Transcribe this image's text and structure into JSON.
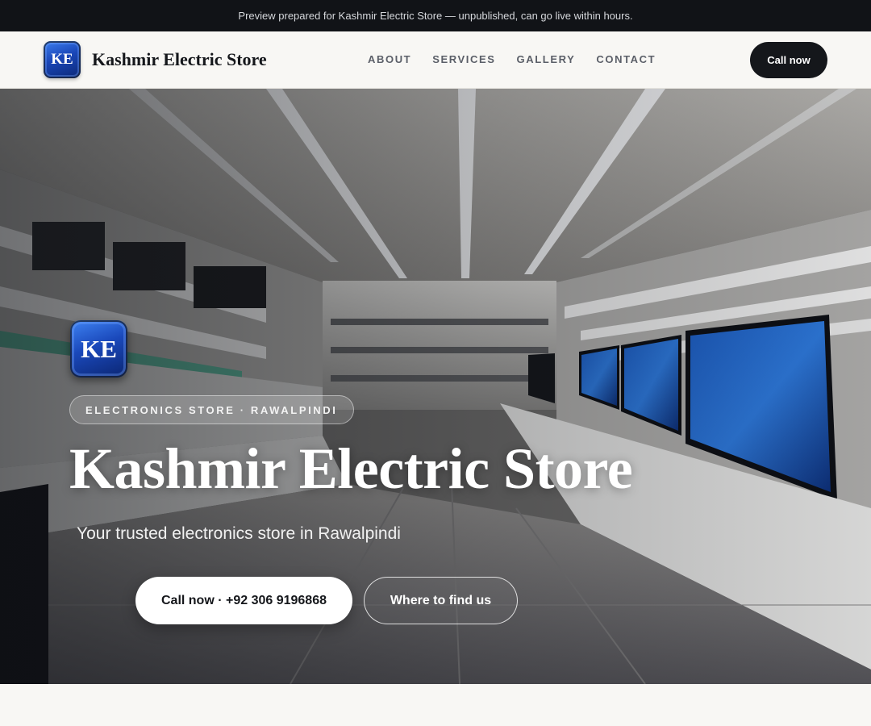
{
  "preview_bar": {
    "text": "Preview prepared for Kashmir Electric Store — unpublished, can go live within hours."
  },
  "header": {
    "logo_text": "KE",
    "brand_name": "Kashmir Electric Store",
    "nav": [
      {
        "label": "ABOUT"
      },
      {
        "label": "SERVICES"
      },
      {
        "label": "GALLERY"
      },
      {
        "label": "CONTACT"
      }
    ],
    "cta_label": "Call now"
  },
  "hero": {
    "logo_text": "KE",
    "badge": "ELECTRONICS STORE · RAWALPINDI",
    "title": "Kashmir Electric Store",
    "subtitle": "Your trusted electronics store in Rawalpindi",
    "primary_button": "Call now · +92 306 9196868",
    "secondary_button": "Where to find us"
  },
  "colors": {
    "dark": "#15171b",
    "page_background": "#f8f7f4",
    "logo_blue": "#1a47b8"
  }
}
